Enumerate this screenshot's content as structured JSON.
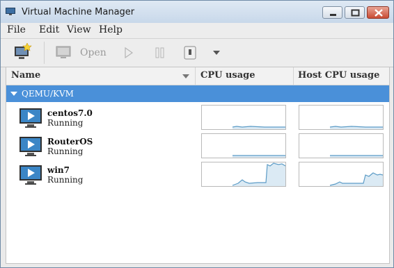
{
  "window": {
    "title": "Virtual Machine Manager"
  },
  "menubar": {
    "file": "File",
    "edit": "Edit",
    "view": "View",
    "help": "Help"
  },
  "toolbar": {
    "open_label": "Open"
  },
  "columns": {
    "name": "Name",
    "cpu": "CPU usage",
    "host_cpu": "Host CPU usage"
  },
  "connection": {
    "label": "QEMU/KVM"
  },
  "vms": [
    {
      "name": "centos7.0",
      "status": "Running"
    },
    {
      "name": "RouterOS",
      "status": "Running"
    },
    {
      "name": "win7",
      "status": "Running"
    }
  ],
  "colors": {
    "selection": "#4a90d9",
    "graph_line": "#5b9bc6",
    "graph_fill": "#dbeaf4"
  }
}
